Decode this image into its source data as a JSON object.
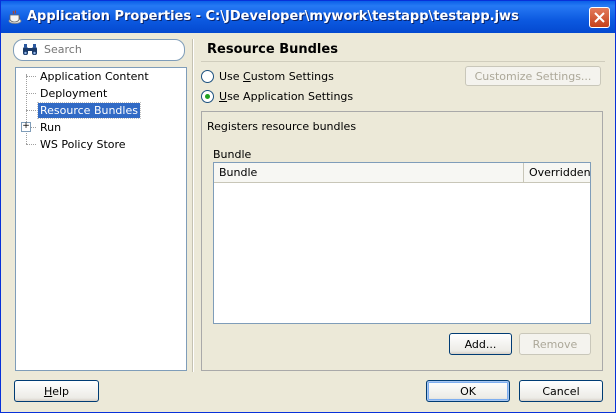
{
  "window": {
    "title": "Application Properties - C:\\JDeveloper\\mywork\\testapp\\testapp.jws",
    "close_icon": "close-icon"
  },
  "sidebar": {
    "search_placeholder": "Search",
    "items": [
      {
        "label": "Application Content"
      },
      {
        "label": "Deployment"
      },
      {
        "label": "Resource Bundles",
        "selected": true
      },
      {
        "label": "Run",
        "expandable": true
      },
      {
        "label": "WS Policy Store"
      }
    ]
  },
  "main": {
    "heading": "Resource Bundles",
    "options": {
      "custom_prefix": "Use ",
      "custom_mnemonic": "C",
      "custom_rest": "ustom Settings",
      "app_mnemonic": "U",
      "app_rest": "se Application Settings",
      "selected": "application"
    },
    "customize_button": "Customize Settings...",
    "description": "Registers resource bundles",
    "bundle_label": "Bundle",
    "table": {
      "columns": [
        "Bundle",
        "Overridden"
      ],
      "rows": []
    },
    "add_button": "Add...",
    "remove_button": "Remove"
  },
  "footer": {
    "help_mnemonic": "H",
    "help_rest": "elp",
    "ok_button": "OK",
    "cancel_button": "Cancel"
  },
  "colors": {
    "titlebar": "#0a5fe8",
    "selection": "#316ac5",
    "window_bg": "#ece9d8"
  }
}
